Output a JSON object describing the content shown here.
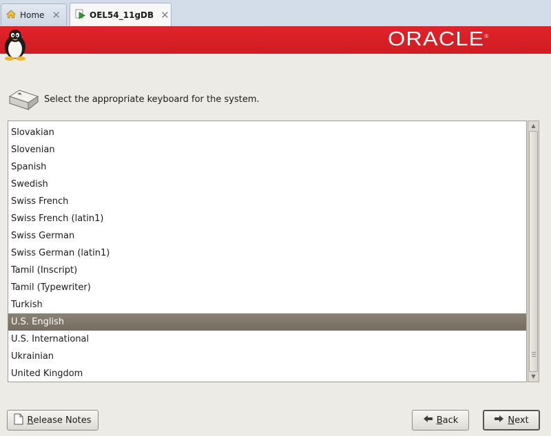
{
  "tabs": [
    {
      "label": "Home",
      "icon": "home-icon",
      "active": false
    },
    {
      "label": "OEL54_11gDB",
      "icon": "vm-play-icon",
      "active": true
    }
  ],
  "banner": {
    "logo_text": "ORACLE",
    "logo_mark": "®",
    "color": "#d8202a",
    "mascot": "tux-penguin-icon"
  },
  "prompt": {
    "text": "Select the appropriate keyboard for the system.",
    "icon": "keyboard-key-icon"
  },
  "keyboards": {
    "items": [
      "Slovakian",
      "Slovenian",
      "Spanish",
      "Swedish",
      "Swiss French",
      "Swiss French (latin1)",
      "Swiss German",
      "Swiss German (latin1)",
      "Tamil (Inscript)",
      "Tamil (Typewriter)",
      "Turkish",
      "U.S. English",
      "U.S. International",
      "Ukrainian",
      "United Kingdom"
    ],
    "selected": "U.S. English"
  },
  "buttons": {
    "release_notes": {
      "first": "R",
      "rest": "elease Notes",
      "icon": "document-icon"
    },
    "back": {
      "first": "B",
      "rest": "ack",
      "icon": "arrow-left-icon"
    },
    "next": {
      "first": "N",
      "rest": "ext",
      "icon": "arrow-right-icon"
    }
  }
}
